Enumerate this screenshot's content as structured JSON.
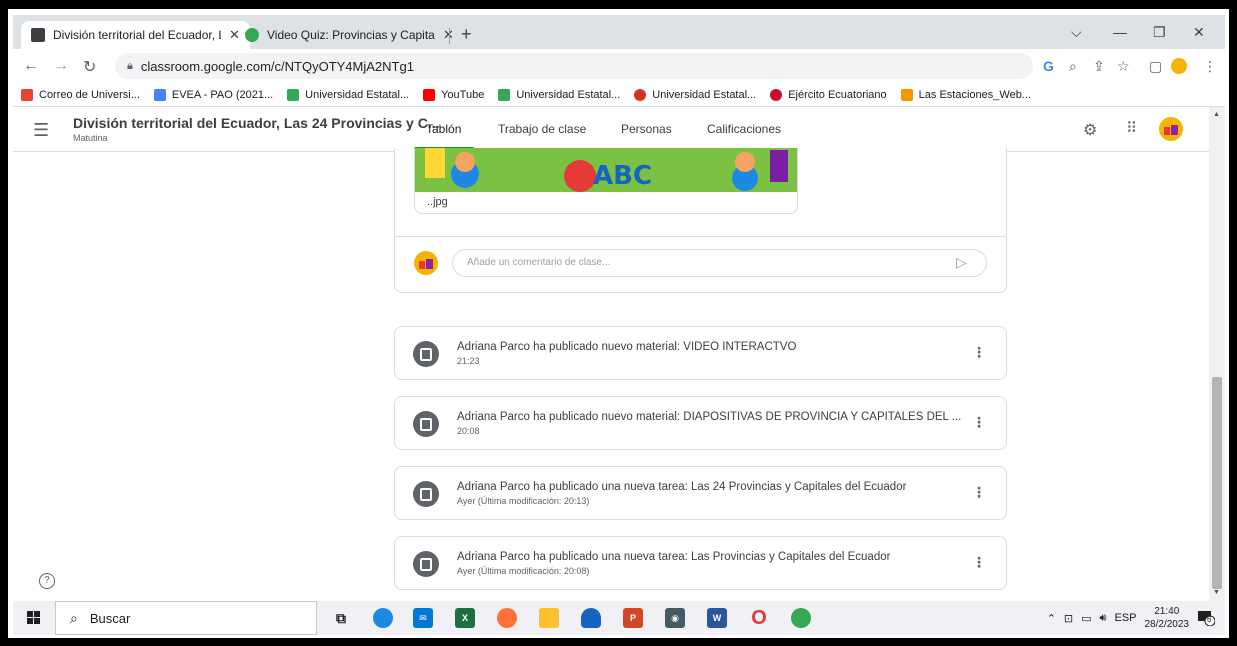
{
  "browser": {
    "tabs": [
      {
        "title": "División territorial del Ecuador, L",
        "active": true,
        "favicon_color": "#3c4043"
      },
      {
        "title": "Video Quiz: Provincias y Capitale",
        "active": false,
        "favicon_color": "#34a853"
      }
    ],
    "new_tab": "+",
    "url": "classroom.google.com/c/NTQyOTY4MjA2NTg1",
    "bookmarks": [
      {
        "label": "Correo de Universi...",
        "color": "#ea4335"
      },
      {
        "label": "EVEA - PAO (2021...",
        "color": "#4285f4"
      },
      {
        "label": "Universidad Estatal...",
        "color": "#34a853"
      },
      {
        "label": "YouTube",
        "color": "#ff0000"
      },
      {
        "label": "Universidad Estatal...",
        "color": "#34a853"
      },
      {
        "label": "Universidad Estatal...",
        "color": "#d93025"
      },
      {
        "label": "Ejército Ecuatoriano",
        "color": "#c8102e"
      },
      {
        "label": "Las Estaciones_Web...",
        "color": "#f29900"
      }
    ]
  },
  "classroom": {
    "class_title": "División territorial del Ecuador, Las 24 Provincias y C...",
    "class_subtitle": "Matutina",
    "tabs": [
      "Tablón",
      "Trabajo de clase",
      "Personas",
      "Calificaciones"
    ],
    "active_tab": "Tablón",
    "accent": "#1e8e3e"
  },
  "stream": {
    "attachment_name": "..jpg",
    "comment_placeholder": "Añade un comentario de clase...",
    "posts": [
      {
        "title": "Adriana Parco ha publicado nuevo material: VIDEO INTERACTVO",
        "time": "21:23",
        "kind": "material-icon"
      },
      {
        "title": "Adriana Parco ha publicado nuevo material: DIAPOSITIVAS DE PROVINCIA Y CAPITALES DEL ...",
        "time": "20:08",
        "kind": "material-icon"
      },
      {
        "title": "Adriana Parco ha publicado una nueva tarea: Las 24 Provincias y Capitales del Ecuador",
        "time": "Ayer (Última modificación: 20:13)",
        "kind": "assignment-icon"
      },
      {
        "title": "Adriana Parco ha publicado una nueva tarea: Las Provincias y Capitales del Ecuador",
        "time": "Ayer (Última modificación: 20:08)",
        "kind": "assignment-icon"
      }
    ]
  },
  "taskbar": {
    "search_label": "Buscar",
    "language": "ESP",
    "time": "21:40",
    "date": "28/2/2023",
    "notification_count": "6"
  }
}
